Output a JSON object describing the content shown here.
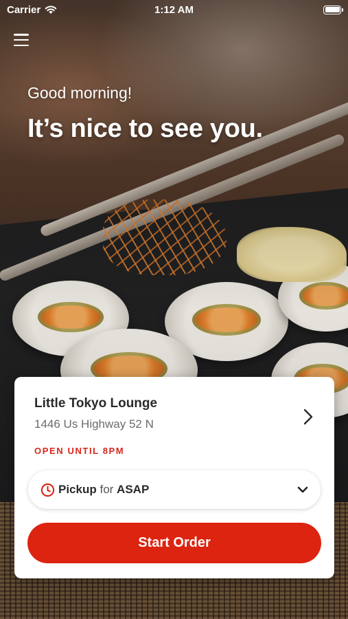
{
  "status_bar": {
    "carrier": "Carrier",
    "time": "1:12 AM"
  },
  "header": {
    "menu_icon": "hamburger-menu-icon",
    "greeting": "Good morning!",
    "headline": "It’s nice to see you."
  },
  "store": {
    "name": "Little Tokyo Lounge",
    "address": "1446 Us Highway 52 N",
    "hours": "OPEN UNTIL 8PM"
  },
  "order_mode": {
    "mode": "Pickup",
    "connector": "for",
    "time": "ASAP"
  },
  "actions": {
    "start_order": "Start Order"
  },
  "colors": {
    "accent": "#dc2410",
    "hours_text": "#d7261c",
    "card_background": "#ffffff"
  }
}
